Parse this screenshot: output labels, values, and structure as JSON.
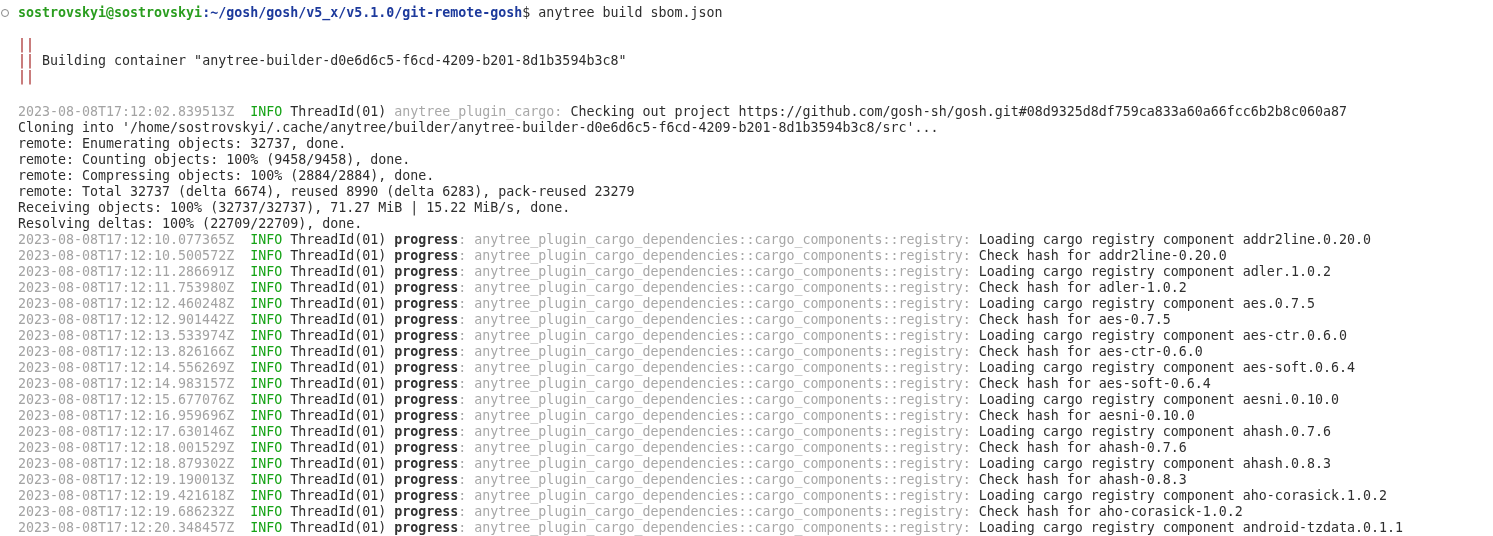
{
  "prompt": {
    "user_host": "sostrovskyi@sostrovskyi",
    "path": ":~/gosh/gosh/v5_x/v5.1.0/git-remote-gosh",
    "symbol": "$",
    "command": " anytree build sbom.json"
  },
  "banner": [
    {
      "bar": "||"
    },
    {
      "bar": "||",
      "text": " Building container \"anytree-builder-d0e6d6c5-f6cd-4209-b201-8d1b3594b3c8\""
    },
    {
      "bar": "||"
    }
  ],
  "output": [
    {
      "kind": "log",
      "timestamp": "2023-08-08T17:12:02.839513Z",
      "level": "INFO",
      "thread": "ThreadId(01)",
      "target": "anytree_plugin_cargo:",
      "message": "Checking out project https://github.com/gosh-sh/gosh.git#08d9325d8df759ca833a60a66fcc6b2b8c060a87"
    },
    {
      "kind": "plain",
      "text": "Cloning into '/home/sostrovskyi/.cache/anytree/builder/anytree-builder-d0e6d6c5-f6cd-4209-b201-8d1b3594b3c8/src'..."
    },
    {
      "kind": "plain",
      "text": "remote: Enumerating objects: 32737, done."
    },
    {
      "kind": "plain",
      "text": "remote: Counting objects: 100% (9458/9458), done."
    },
    {
      "kind": "plain",
      "text": "remote: Compressing objects: 100% (2884/2884), done."
    },
    {
      "kind": "plain",
      "text": "remote: Total 32737 (delta 6674), reused 8990 (delta 6283), pack-reused 23279"
    },
    {
      "kind": "plain",
      "text": "Receiving objects: 100% (32737/32737), 71.27 MiB | 15.22 MiB/s, done."
    },
    {
      "kind": "plain",
      "text": "Resolving deltas: 100% (22709/22709), done."
    },
    {
      "kind": "log",
      "timestamp": "2023-08-08T17:12:10.077365Z",
      "level": "INFO",
      "thread": "ThreadId(01)",
      "span": "progress",
      "target": ": anytree_plugin_cargo_dependencies::cargo_components::registry:",
      "message": "Loading cargo registry component addr2line.0.20.0"
    },
    {
      "kind": "log",
      "timestamp": "2023-08-08T17:12:10.500572Z",
      "level": "INFO",
      "thread": "ThreadId(01)",
      "span": "progress",
      "target": ": anytree_plugin_cargo_dependencies::cargo_components::registry:",
      "message": "Check hash for addr2line-0.20.0"
    },
    {
      "kind": "log",
      "timestamp": "2023-08-08T17:12:11.286691Z",
      "level": "INFO",
      "thread": "ThreadId(01)",
      "span": "progress",
      "target": ": anytree_plugin_cargo_dependencies::cargo_components::registry:",
      "message": "Loading cargo registry component adler.1.0.2"
    },
    {
      "kind": "log",
      "timestamp": "2023-08-08T17:12:11.753980Z",
      "level": "INFO",
      "thread": "ThreadId(01)",
      "span": "progress",
      "target": ": anytree_plugin_cargo_dependencies::cargo_components::registry:",
      "message": "Check hash for adler-1.0.2"
    },
    {
      "kind": "log",
      "timestamp": "2023-08-08T17:12:12.460248Z",
      "level": "INFO",
      "thread": "ThreadId(01)",
      "span": "progress",
      "target": ": anytree_plugin_cargo_dependencies::cargo_components::registry:",
      "message": "Loading cargo registry component aes.0.7.5"
    },
    {
      "kind": "log",
      "timestamp": "2023-08-08T17:12:12.901442Z",
      "level": "INFO",
      "thread": "ThreadId(01)",
      "span": "progress",
      "target": ": anytree_plugin_cargo_dependencies::cargo_components::registry:",
      "message": "Check hash for aes-0.7.5"
    },
    {
      "kind": "log",
      "timestamp": "2023-08-08T17:12:13.533974Z",
      "level": "INFO",
      "thread": "ThreadId(01)",
      "span": "progress",
      "target": ": anytree_plugin_cargo_dependencies::cargo_components::registry:",
      "message": "Loading cargo registry component aes-ctr.0.6.0"
    },
    {
      "kind": "log",
      "timestamp": "2023-08-08T17:12:13.826166Z",
      "level": "INFO",
      "thread": "ThreadId(01)",
      "span": "progress",
      "target": ": anytree_plugin_cargo_dependencies::cargo_components::registry:",
      "message": "Check hash for aes-ctr-0.6.0"
    },
    {
      "kind": "log",
      "timestamp": "2023-08-08T17:12:14.556269Z",
      "level": "INFO",
      "thread": "ThreadId(01)",
      "span": "progress",
      "target": ": anytree_plugin_cargo_dependencies::cargo_components::registry:",
      "message": "Loading cargo registry component aes-soft.0.6.4"
    },
    {
      "kind": "log",
      "timestamp": "2023-08-08T17:12:14.983157Z",
      "level": "INFO",
      "thread": "ThreadId(01)",
      "span": "progress",
      "target": ": anytree_plugin_cargo_dependencies::cargo_components::registry:",
      "message": "Check hash for aes-soft-0.6.4"
    },
    {
      "kind": "log",
      "timestamp": "2023-08-08T17:12:15.677076Z",
      "level": "INFO",
      "thread": "ThreadId(01)",
      "span": "progress",
      "target": ": anytree_plugin_cargo_dependencies::cargo_components::registry:",
      "message": "Loading cargo registry component aesni.0.10.0"
    },
    {
      "kind": "log",
      "timestamp": "2023-08-08T17:12:16.959696Z",
      "level": "INFO",
      "thread": "ThreadId(01)",
      "span": "progress",
      "target": ": anytree_plugin_cargo_dependencies::cargo_components::registry:",
      "message": "Check hash for aesni-0.10.0"
    },
    {
      "kind": "log",
      "timestamp": "2023-08-08T17:12:17.630146Z",
      "level": "INFO",
      "thread": "ThreadId(01)",
      "span": "progress",
      "target": ": anytree_plugin_cargo_dependencies::cargo_components::registry:",
      "message": "Loading cargo registry component ahash.0.7.6"
    },
    {
      "kind": "log",
      "timestamp": "2023-08-08T17:12:18.001529Z",
      "level": "INFO",
      "thread": "ThreadId(01)",
      "span": "progress",
      "target": ": anytree_plugin_cargo_dependencies::cargo_components::registry:",
      "message": "Check hash for ahash-0.7.6"
    },
    {
      "kind": "log",
      "timestamp": "2023-08-08T17:12:18.879302Z",
      "level": "INFO",
      "thread": "ThreadId(01)",
      "span": "progress",
      "target": ": anytree_plugin_cargo_dependencies::cargo_components::registry:",
      "message": "Loading cargo registry component ahash.0.8.3"
    },
    {
      "kind": "log",
      "timestamp": "2023-08-08T17:12:19.190013Z",
      "level": "INFO",
      "thread": "ThreadId(01)",
      "span": "progress",
      "target": ": anytree_plugin_cargo_dependencies::cargo_components::registry:",
      "message": "Check hash for ahash-0.8.3"
    },
    {
      "kind": "log",
      "timestamp": "2023-08-08T17:12:19.421618Z",
      "level": "INFO",
      "thread": "ThreadId(01)",
      "span": "progress",
      "target": ": anytree_plugin_cargo_dependencies::cargo_components::registry:",
      "message": "Loading cargo registry component aho-corasick.1.0.2"
    },
    {
      "kind": "log",
      "timestamp": "2023-08-08T17:12:19.686232Z",
      "level": "INFO",
      "thread": "ThreadId(01)",
      "span": "progress",
      "target": ": anytree_plugin_cargo_dependencies::cargo_components::registry:",
      "message": "Check hash for aho-corasick-1.0.2"
    },
    {
      "kind": "log",
      "timestamp": "2023-08-08T17:12:20.348457Z",
      "level": "INFO",
      "thread": "ThreadId(01)",
      "span": "progress",
      "target": ": anytree_plugin_cargo_dependencies::cargo_components::registry:",
      "message": "Loading cargo registry component android-tzdata.0.1.1"
    }
  ]
}
